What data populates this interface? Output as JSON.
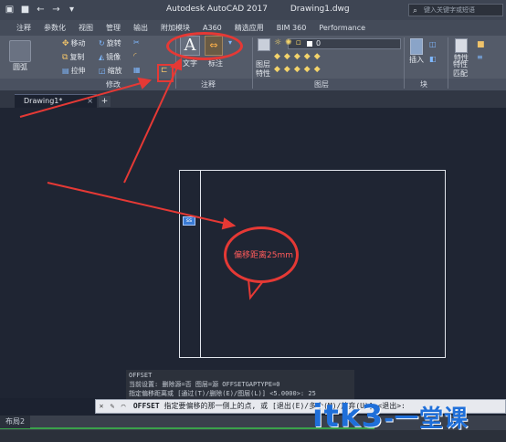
{
  "titlebar": {
    "app_title": "Autodesk AutoCAD 2017",
    "doc_title": "Drawing1.dwg",
    "search_placeholder": "键入关键字或短语"
  },
  "ribbon": {
    "tabs": [
      "注释",
      "参数化",
      "视图",
      "管理",
      "输出",
      "附加模块",
      "A360",
      "精选应用",
      "BIM 360",
      "Performance"
    ],
    "modify_tools": [
      {
        "label": "移动",
        "icon": "move-icon"
      },
      {
        "label": "旋转",
        "icon": "rotate-icon"
      },
      {
        "label": "复制",
        "icon": "copy-icon"
      },
      {
        "label": "镜像",
        "icon": "mirror-icon"
      },
      {
        "label": "拉伸",
        "icon": "stretch-icon"
      },
      {
        "label": "缩放",
        "icon": "scale-icon"
      }
    ],
    "draw_partial_label": "圆弧",
    "text_label": "文字",
    "dim_label": "标注",
    "layer_prop_label": "图层\n特性",
    "layer_value": "0",
    "insert_label": "插入",
    "props_label": "特性",
    "match_label": "特性\n匹配",
    "panels": {
      "modify": "修改",
      "annotation": "注释",
      "layer": "图层",
      "block": "块"
    }
  },
  "filetabs": {
    "active": "Drawing1*"
  },
  "canvas": {
    "callout_text": "偏移距离25mm",
    "grip_label": "ss"
  },
  "history": {
    "lines": [
      "OFFSET",
      "当前设置: 删除源=否  图层=源  OFFSETGAPTYPE=0",
      "指定偏移距离或 [通过(T)/删除(E)/图层(L)] <5.0000>: 25"
    ]
  },
  "command": {
    "prompt": "OFFSET",
    "text": " 指定要偏移的那一侧上的点, 或 [退出(E)/多个(M)/放弃(U)] <退出>:"
  },
  "layout": {
    "tab": "布局2"
  },
  "watermark": {
    "text": "itk3",
    "suffix": "-一堂课"
  },
  "colors": {
    "annotation_red": "#e53935",
    "watermark_blue": "#1f6fd9"
  }
}
